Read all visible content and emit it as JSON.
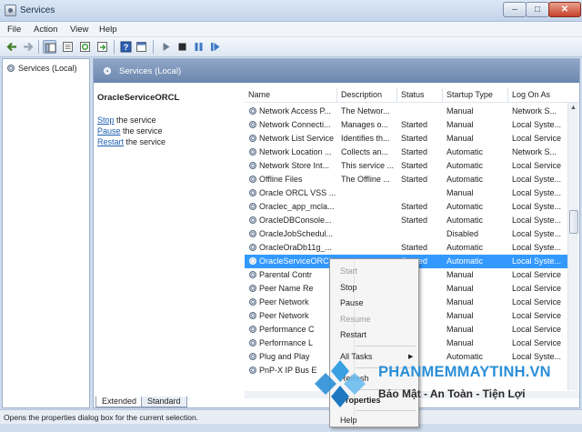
{
  "window": {
    "title": "Services"
  },
  "menu": [
    "File",
    "Action",
    "View",
    "Help"
  ],
  "tree": {
    "root_label": "Services (Local)"
  },
  "main": {
    "header_label": "Services (Local)",
    "selected_service": "OracleServiceORCL",
    "actions": [
      {
        "link": "Stop",
        "rest": " the service"
      },
      {
        "link": "Pause",
        "rest": " the service"
      },
      {
        "link": "Restart",
        "rest": " the service"
      }
    ]
  },
  "list": {
    "columns": [
      "Name",
      "Description",
      "Status",
      "Startup Type",
      "Log On As"
    ],
    "rows": [
      {
        "name": "Network Access P...",
        "desc": "The Networ...",
        "status": "",
        "startup": "Manual",
        "logon": "Network S..."
      },
      {
        "name": "Network Connecti...",
        "desc": "Manages o...",
        "status": "Started",
        "startup": "Manual",
        "logon": "Local Syste..."
      },
      {
        "name": "Network List Service",
        "desc": "Identifies th...",
        "status": "Started",
        "startup": "Manual",
        "logon": "Local Service"
      },
      {
        "name": "Network Location ...",
        "desc": "Collects an...",
        "status": "Started",
        "startup": "Automatic",
        "logon": "Network S..."
      },
      {
        "name": "Network Store Int...",
        "desc": "This service ...",
        "status": "Started",
        "startup": "Automatic",
        "logon": "Local Service"
      },
      {
        "name": "Offline Files",
        "desc": "The Offline ...",
        "status": "Started",
        "startup": "Automatic",
        "logon": "Local Syste..."
      },
      {
        "name": "Oracle ORCL VSS ...",
        "desc": "",
        "status": "",
        "startup": "Manual",
        "logon": "Local Syste..."
      },
      {
        "name": "Oraclec_app_mcla...",
        "desc": "",
        "status": "Started",
        "startup": "Automatic",
        "logon": "Local Syste..."
      },
      {
        "name": "OracleDBConsole...",
        "desc": "",
        "status": "Started",
        "startup": "Automatic",
        "logon": "Local Syste..."
      },
      {
        "name": "OracleJobSchedul...",
        "desc": "",
        "status": "",
        "startup": "Disabled",
        "logon": "Local Syste..."
      },
      {
        "name": "OracleOraDb11g_...",
        "desc": "",
        "status": "Started",
        "startup": "Automatic",
        "logon": "Local Syste..."
      },
      {
        "name": "OracleServiceORCL",
        "desc": "",
        "status": "Started",
        "startup": "Automatic",
        "logon": "Local Syste..."
      },
      {
        "name": "Parental Contr",
        "desc": "",
        "status": "",
        "startup": "Manual",
        "logon": "Local Service"
      },
      {
        "name": "Peer Name Re",
        "desc": "",
        "status": "ted",
        "startup": "Manual",
        "logon": "Local Service"
      },
      {
        "name": "Peer Network",
        "desc": "",
        "status": "ted",
        "startup": "Manual",
        "logon": "Local Service"
      },
      {
        "name": "Peer Network",
        "desc": "",
        "status": "ted",
        "startup": "Manual",
        "logon": "Local Service"
      },
      {
        "name": "Performance C",
        "desc": "",
        "status": "",
        "startup": "Manual",
        "logon": "Local Service"
      },
      {
        "name": "Performance L",
        "desc": "",
        "status": "",
        "startup": "Manual",
        "logon": "Local Service"
      },
      {
        "name": "Plug and Play",
        "desc": "",
        "status": "ted",
        "startup": "Automatic",
        "logon": "Local Syste..."
      },
      {
        "name": "PnP-X IP Bus E",
        "desc": "",
        "status": "",
        "startup": "",
        "logon": ""
      }
    ]
  },
  "context_menu": {
    "start": "Start",
    "stop": "Stop",
    "pause": "Pause",
    "resume": "Resume",
    "restart": "Restart",
    "all_tasks": "All Tasks",
    "refresh": "Refresh",
    "properties": "Properties",
    "help": "Help"
  },
  "tabs": [
    "Extended",
    "Standard"
  ],
  "status_bar": "Opens the properties dialog box for the current selection.",
  "watermark": {
    "main": "PHANMEMMAYTINH.VN",
    "tagline": "Bảo Mật - An Toàn - Tiện Lợi"
  },
  "colors": {
    "selection": "#3399ff",
    "header": "#7891b8",
    "watermark_blue": "#2b8fd8"
  },
  "icons": [
    "back-arrow-icon",
    "forward-arrow-icon",
    "show-tree-icon",
    "properties-icon",
    "refresh-icon",
    "export-icon",
    "help-icon",
    "play-icon",
    "stop-icon",
    "pause-icon",
    "restart-icon",
    "gear-icon"
  ]
}
